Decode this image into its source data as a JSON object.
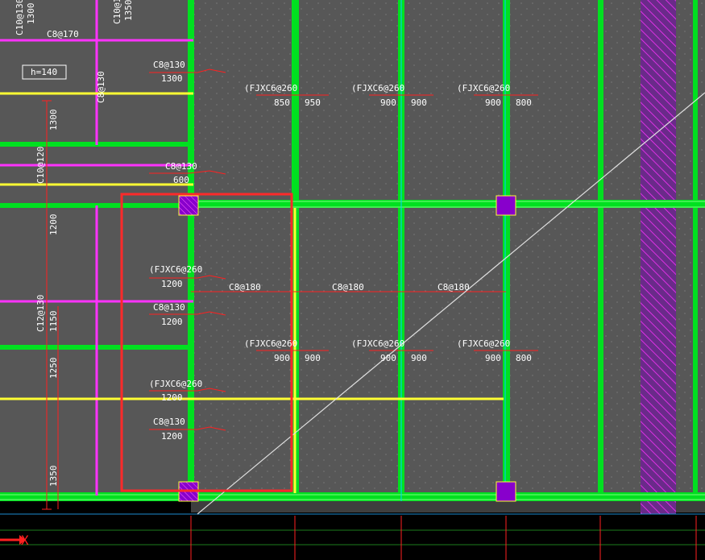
{
  "drawing": {
    "colors": {
      "background": "#000000",
      "slab": "#575757",
      "beam": "#00e020",
      "beam_light": "#7cff7c",
      "magenta": "#ff33ff",
      "yellow": "#ffff33",
      "red": "#ff2020",
      "selection": "#ff2a2a",
      "text": "#ffffff",
      "column": "#8800cc",
      "axis_grid": "#1d7d1d",
      "x_marker": "#ff2020"
    },
    "labels": {
      "left_top_v1": "C10@130",
      "left_top_v2": "1300",
      "left_top_v3": "C10@12",
      "left_top_v4": "1350",
      "c8_170": "C8@170",
      "h140": "h=140",
      "c8_130_a": "C8@130",
      "n1300_a": "1300",
      "c8_130_v": "C8@130",
      "n1300_v": "1300",
      "c10_120_v": "C10@120",
      "c8_130_b": "C8@130",
      "n600": "600",
      "n1200_v": "1200",
      "fjx_l1": "(FJXC6@260",
      "n1200_a": "1200",
      "c8_130_c": "C8@130",
      "n1200_b": "1200",
      "c12_130_v": "C12@130",
      "n1150_v": "1150",
      "n1250_v": "1250",
      "fjx_l2": "(FJXC6@260",
      "n1200_c": "1200",
      "c8_130_d": "C8@130",
      "n1200_d": "1200",
      "n1350_v": "1350",
      "c8_180_a": "C8@180",
      "c8_180_b": "C8@180",
      "c8_180_c": "C8@180",
      "fjx_t1": "(FJXC6@260",
      "t1_a": "850",
      "t1_b": "950",
      "fjx_t2": "(FJXC6@260",
      "t2_a": "900",
      "t2_b": "900",
      "fjx_t3": "(FJXC6@260",
      "t3_a": "900",
      "t3_b": "800",
      "fjx_m1": "(FJXC6@260",
      "m1_a": "900",
      "m1_b": "900",
      "fjx_m2": "(FJXC6@260",
      "m2_a": "900",
      "m2_b": "900",
      "fjx_m3": "(FJXC6@260",
      "m3_a": "900",
      "m3_b": "800",
      "x_axis": "X"
    }
  }
}
